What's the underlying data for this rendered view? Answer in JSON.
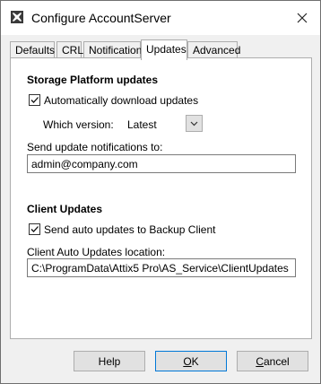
{
  "window": {
    "title": "Configure AccountServer"
  },
  "tabs": [
    {
      "label": "Defaults"
    },
    {
      "label": "CRL"
    },
    {
      "label": "Notification"
    },
    {
      "label": "Updates"
    },
    {
      "label": "Advanced"
    }
  ],
  "active_tab": "Updates",
  "storage": {
    "heading": "Storage Platform updates",
    "auto_download_label": "Automatically download updates",
    "auto_download_checked": true,
    "version_label": "Which version:",
    "version_value": "Latest",
    "notify_label": "Send update notifications to:",
    "notify_value": "admin@company.com"
  },
  "client": {
    "heading": "Client Updates",
    "send_auto_label": "Send auto updates to Backup Client",
    "send_auto_checked": true,
    "location_label": "Client Auto Updates location:",
    "location_value": "C:\\ProgramData\\Attix5 Pro\\AS_Service\\ClientUpdates"
  },
  "buttons": {
    "help": "Help",
    "ok_first": "O",
    "ok_rest": "K",
    "cancel_first": "C",
    "cancel_rest": "ancel"
  },
  "icons": {
    "app": "app-icon",
    "close": "close-icon",
    "check": "checkmark-icon",
    "dropdown": "chevron-down-icon"
  }
}
